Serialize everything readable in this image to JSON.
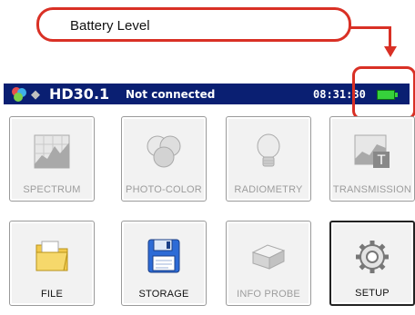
{
  "callout": {
    "text": "Battery Level"
  },
  "statusbar": {
    "model": "HD30.1",
    "connection": "Not connected",
    "time": "08:31:30",
    "battery_level": 1.0,
    "battery_color": "#36d13b",
    "bar_color": "#0a1f72"
  },
  "tiles": [
    {
      "label": "SPECTRUM",
      "icon": "spectrum-chart-icon",
      "enabled": false
    },
    {
      "label": "PHOTO-COLOR",
      "icon": "color-circles-icon",
      "enabled": false
    },
    {
      "label": "RADIOMETRY",
      "icon": "light-bulb-icon",
      "enabled": false
    },
    {
      "label": "TRANSMISSION",
      "icon": "transmission-chart-icon",
      "enabled": false
    },
    {
      "label": "FILE",
      "icon": "folder-icon",
      "enabled": true
    },
    {
      "label": "STORAGE",
      "icon": "floppy-disk-icon",
      "enabled": true
    },
    {
      "label": "INFO PROBE",
      "icon": "probe-box-icon",
      "enabled": false
    },
    {
      "label": "SETUP",
      "icon": "gear-icon",
      "enabled": true,
      "selected": true
    }
  ],
  "colors": {
    "callout_red": "#d93025",
    "disabled_text": "#9d9d9d"
  }
}
